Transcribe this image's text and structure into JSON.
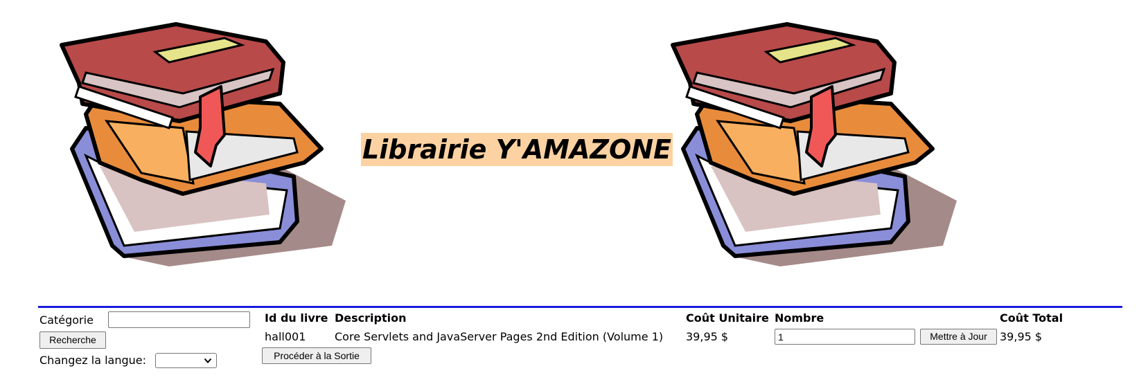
{
  "header": {
    "title": "Librairie Y'AMAZONE",
    "images": [
      "books-stack-icon",
      "books-stack-icon"
    ]
  },
  "sidebar": {
    "category_label": "Catégorie",
    "category_value": "",
    "search_button": "Recherche",
    "language_label": "Changez la langue:",
    "language_selected": ""
  },
  "cart": {
    "columns": [
      "Id du livre",
      "Description",
      "Coût Unitaire",
      "Nombre",
      "Coût Total"
    ],
    "rows": [
      {
        "id": "hall001",
        "description": "Core Servlets and JavaServer Pages 2nd Edition (Volume 1)",
        "unit_cost": "39,95 $",
        "quantity": "1",
        "update_button": "Mettre à Jour",
        "total": "39,95 $"
      }
    ],
    "checkout_button": "Procéder à la Sortie"
  },
  "colors": {
    "title_bg": "#fcd2a2",
    "rule": "#1a1ae0"
  }
}
